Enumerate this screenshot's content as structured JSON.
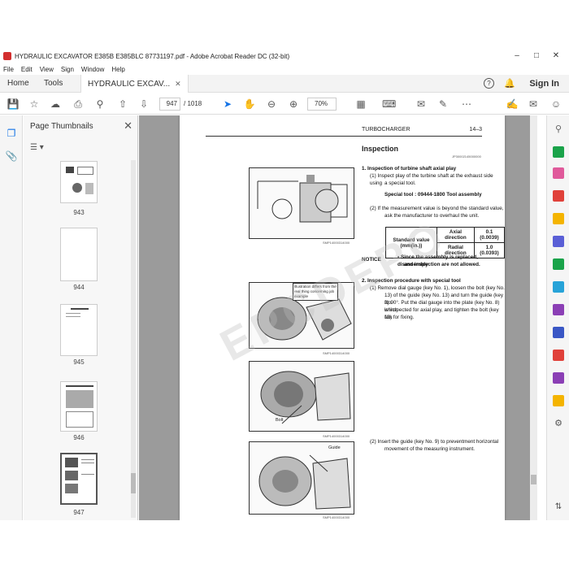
{
  "window": {
    "title": "HYDRAULIC EXCAVATOR E385B E385BLC 87731197.pdf - Adobe Acrobat Reader DC (32-bit)"
  },
  "menu": [
    "File",
    "Edit",
    "View",
    "Sign",
    "Window",
    "Help"
  ],
  "tabs": {
    "home": "Home",
    "tools": "Tools",
    "document": "HYDRAULIC EXCAV...",
    "sign_in": "Sign In"
  },
  "toolbar": {
    "page_current": "947",
    "page_total": "/ 1018",
    "zoom": "70%"
  },
  "thumbnails_panel": {
    "title": "Page Thumbnails",
    "pages": [
      "943",
      "944",
      "945",
      "946",
      "947"
    ],
    "selected": "947"
  },
  "page": {
    "header_left": "TURBOCHARGER",
    "header_right": "14–3",
    "heading": "Inspection",
    "code_top": "JP30002145000000",
    "step1_title": "1.   Inspection of turbine shaft axial play",
    "step1_1": "(1)   Inspect play of the turbine shaft at the exhaust side using",
    "step1_1b": "a special tool.",
    "special_tool": "Special tool :  09444-1800 Tool assembly",
    "step1_2": "(2)   If the measurement value is beyond the standard value,",
    "step1_2b": "ask the manufacturer to overhaul the unit.",
    "table": {
      "label": "Standard value (mm(in.))",
      "rows": [
        {
          "dir": "Axial direction",
          "val": "0.1 (0.0039)"
        },
        {
          "dir": "Radial direction",
          "val": "1.0 (0.0393)"
        }
      ]
    },
    "notice_label": "NOTICE",
    "notice_text": "Since the assembly is replaced,  disassembly",
    "notice_text2": "and inspection are not allowed.",
    "step2_title": "2.   Inspection procedure with special tool",
    "step2_1": [
      "(1)   Remove dial gauge (key No. 1),  loosen the bolt (key No.",
      "13) of the guide (key No. 13) and turn the guide (key No.",
      "2) 90°. Put the dial gauge into the plate (key No. 8) which",
      "is inspected for axial play,  and tighten the bolt (key No.",
      "19) for fixing."
    ],
    "step2_2": [
      "(2)   Insert the guide (key No. 9) to preventment horizontal",
      "movement of the measuring instrument."
    ],
    "callout": "Illustration differs from the real thing concerning job example",
    "fig_codes": [
      "SMP14000314000",
      "SMP14000314000",
      "SMP14000314000",
      "SMP14000314000"
    ],
    "label_bolt": "Bolt",
    "label_guide": "Guide",
    "watermark": "EPCDEPO"
  },
  "colors": {
    "accent": "#1473e6",
    "doc_bg": "#9b9b9b"
  }
}
